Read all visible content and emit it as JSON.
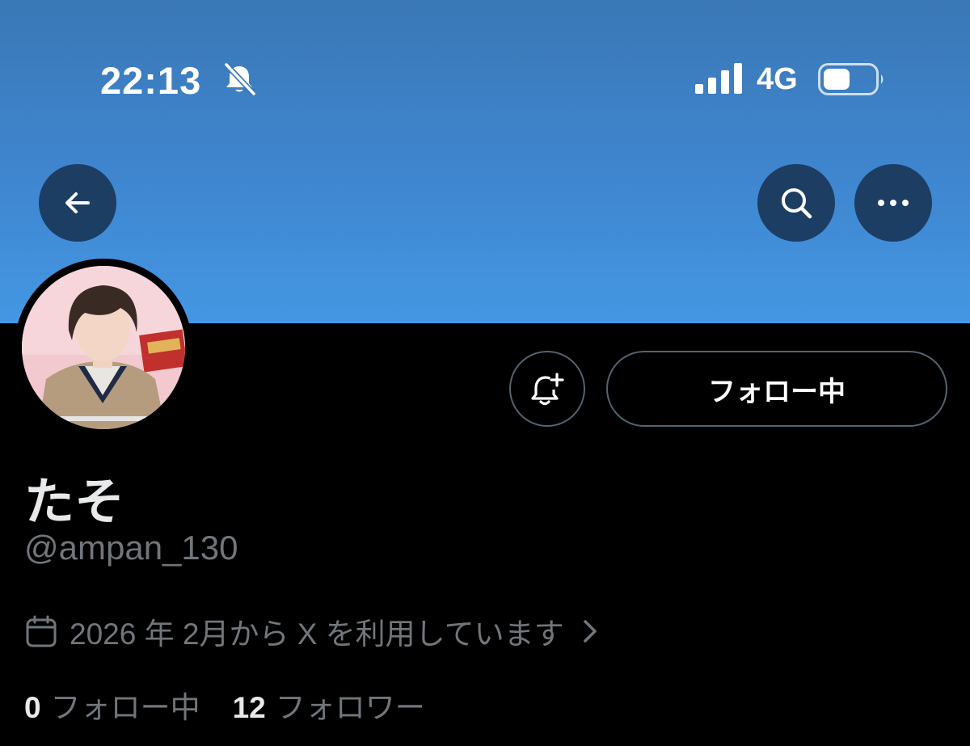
{
  "status_bar": {
    "time": "22:13",
    "network": "4G",
    "icons": [
      "bell-slash-icon",
      "signal-bars-icon",
      "battery-icon"
    ]
  },
  "header": {
    "icons": [
      "back-arrow-icon",
      "search-icon",
      "more-icon"
    ],
    "banner_color": "#4497e3"
  },
  "profile": {
    "display_name": "たそ",
    "handle": "@ampan_130",
    "joined_text": "2026 年 2月から X を利用しています",
    "following_button_label": "フォロー中",
    "stats": [
      {
        "count": "0",
        "label": "フォロー中"
      },
      {
        "count": "12",
        "label": "フォロワー"
      }
    ]
  },
  "colors": {
    "background": "#000000",
    "primary_text": "#e7e9ea",
    "secondary_text": "#71767b",
    "border": "#536471"
  }
}
